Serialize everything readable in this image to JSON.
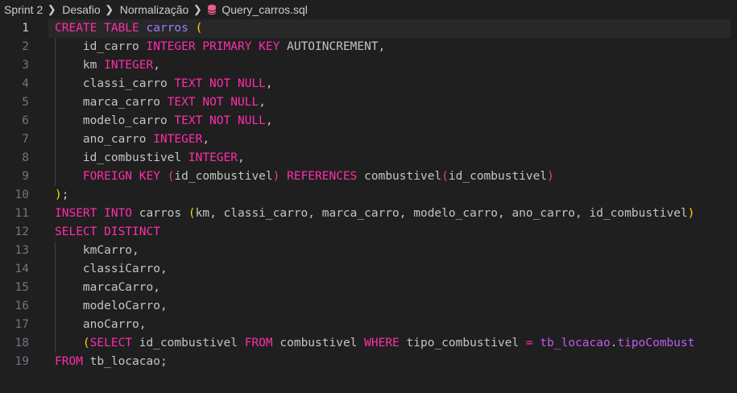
{
  "breadcrumb": {
    "items": [
      "Sprint 2",
      "Desafio",
      "Normalização",
      "Query_carros.sql"
    ]
  },
  "editor": {
    "active_line": "1",
    "line_numbers": [
      "1",
      "2",
      "3",
      "4",
      "5",
      "6",
      "7",
      "8",
      "9",
      "10",
      "11",
      "12",
      "13",
      "14",
      "15",
      "16",
      "17",
      "18",
      "19"
    ],
    "lines": [
      [
        [
          "k",
          "CREATE TABLE "
        ],
        [
          "id",
          "carros"
        ],
        [
          "t",
          " "
        ],
        [
          "y",
          "("
        ]
      ],
      [
        [
          "t",
          "    id_carro "
        ],
        [
          "k",
          "INTEGER PRIMARY KEY "
        ],
        [
          "t",
          "AUTOINCREMENT,"
        ]
      ],
      [
        [
          "t",
          "    km "
        ],
        [
          "k",
          "INTEGER"
        ],
        [
          "t",
          ","
        ]
      ],
      [
        [
          "t",
          "    classi_carro "
        ],
        [
          "k",
          "TEXT NOT NULL"
        ],
        [
          "t",
          ","
        ]
      ],
      [
        [
          "t",
          "    marca_carro "
        ],
        [
          "k",
          "TEXT NOT NULL"
        ],
        [
          "t",
          ","
        ]
      ],
      [
        [
          "t",
          "    modelo_carro "
        ],
        [
          "k",
          "TEXT NOT NULL"
        ],
        [
          "t",
          ","
        ]
      ],
      [
        [
          "t",
          "    ano_carro "
        ],
        [
          "k",
          "INTEGER"
        ],
        [
          "t",
          ","
        ]
      ],
      [
        [
          "t",
          "    id_combustivel "
        ],
        [
          "k",
          "INTEGER"
        ],
        [
          "t",
          ","
        ]
      ],
      [
        [
          "t",
          "    "
        ],
        [
          "k",
          "FOREIGN KEY "
        ],
        [
          "p",
          "("
        ],
        [
          "t",
          "id_combustivel"
        ],
        [
          "p",
          ")"
        ],
        [
          "t",
          " "
        ],
        [
          "k",
          "REFERENCES "
        ],
        [
          "t",
          "combustivel"
        ],
        [
          "p",
          "("
        ],
        [
          "t",
          "id_combustivel"
        ],
        [
          "p",
          ")"
        ]
      ],
      [
        [
          "y",
          ")"
        ],
        [
          "t",
          ";"
        ]
      ],
      [
        [
          "k",
          "INSERT INTO "
        ],
        [
          "t",
          "carros "
        ],
        [
          "y",
          "("
        ],
        [
          "t",
          "km, classi_carro, marca_carro, modelo_carro, ano_carro, id_combustivel"
        ],
        [
          "y",
          ")"
        ]
      ],
      [
        [
          "k",
          "SELECT DISTINCT"
        ]
      ],
      [
        [
          "t",
          "    kmCarro,"
        ]
      ],
      [
        [
          "t",
          "    classiCarro,"
        ]
      ],
      [
        [
          "t",
          "    marcaCarro,"
        ]
      ],
      [
        [
          "t",
          "    modeloCarro,"
        ]
      ],
      [
        [
          "t",
          "    anoCarro,"
        ]
      ],
      [
        [
          "t",
          "    "
        ],
        [
          "y",
          "("
        ],
        [
          "k",
          "SELECT "
        ],
        [
          "t",
          "id_combustivel "
        ],
        [
          "k",
          "FROM "
        ],
        [
          "t",
          "combustivel "
        ],
        [
          "k",
          "WHERE "
        ],
        [
          "t",
          "tipo_combustivel "
        ],
        [
          "o",
          "= "
        ],
        [
          "v",
          "tb_locacao"
        ],
        [
          "t",
          "."
        ],
        [
          "v",
          "tipoCombust"
        ]
      ],
      [
        [
          "k",
          "FROM "
        ],
        [
          "t",
          "tb_locacao;"
        ]
      ]
    ]
  },
  "colors": {
    "background": "#1f1f1f",
    "keyword": "#ff2eaa",
    "bracket": "#ffd700",
    "identifier": "#a27bff",
    "text": "#d4d4d4",
    "line_number": "#6e7681"
  },
  "icons": {
    "breadcrumb_separator": "chevron-right-icon",
    "file_type": "database-icon"
  }
}
